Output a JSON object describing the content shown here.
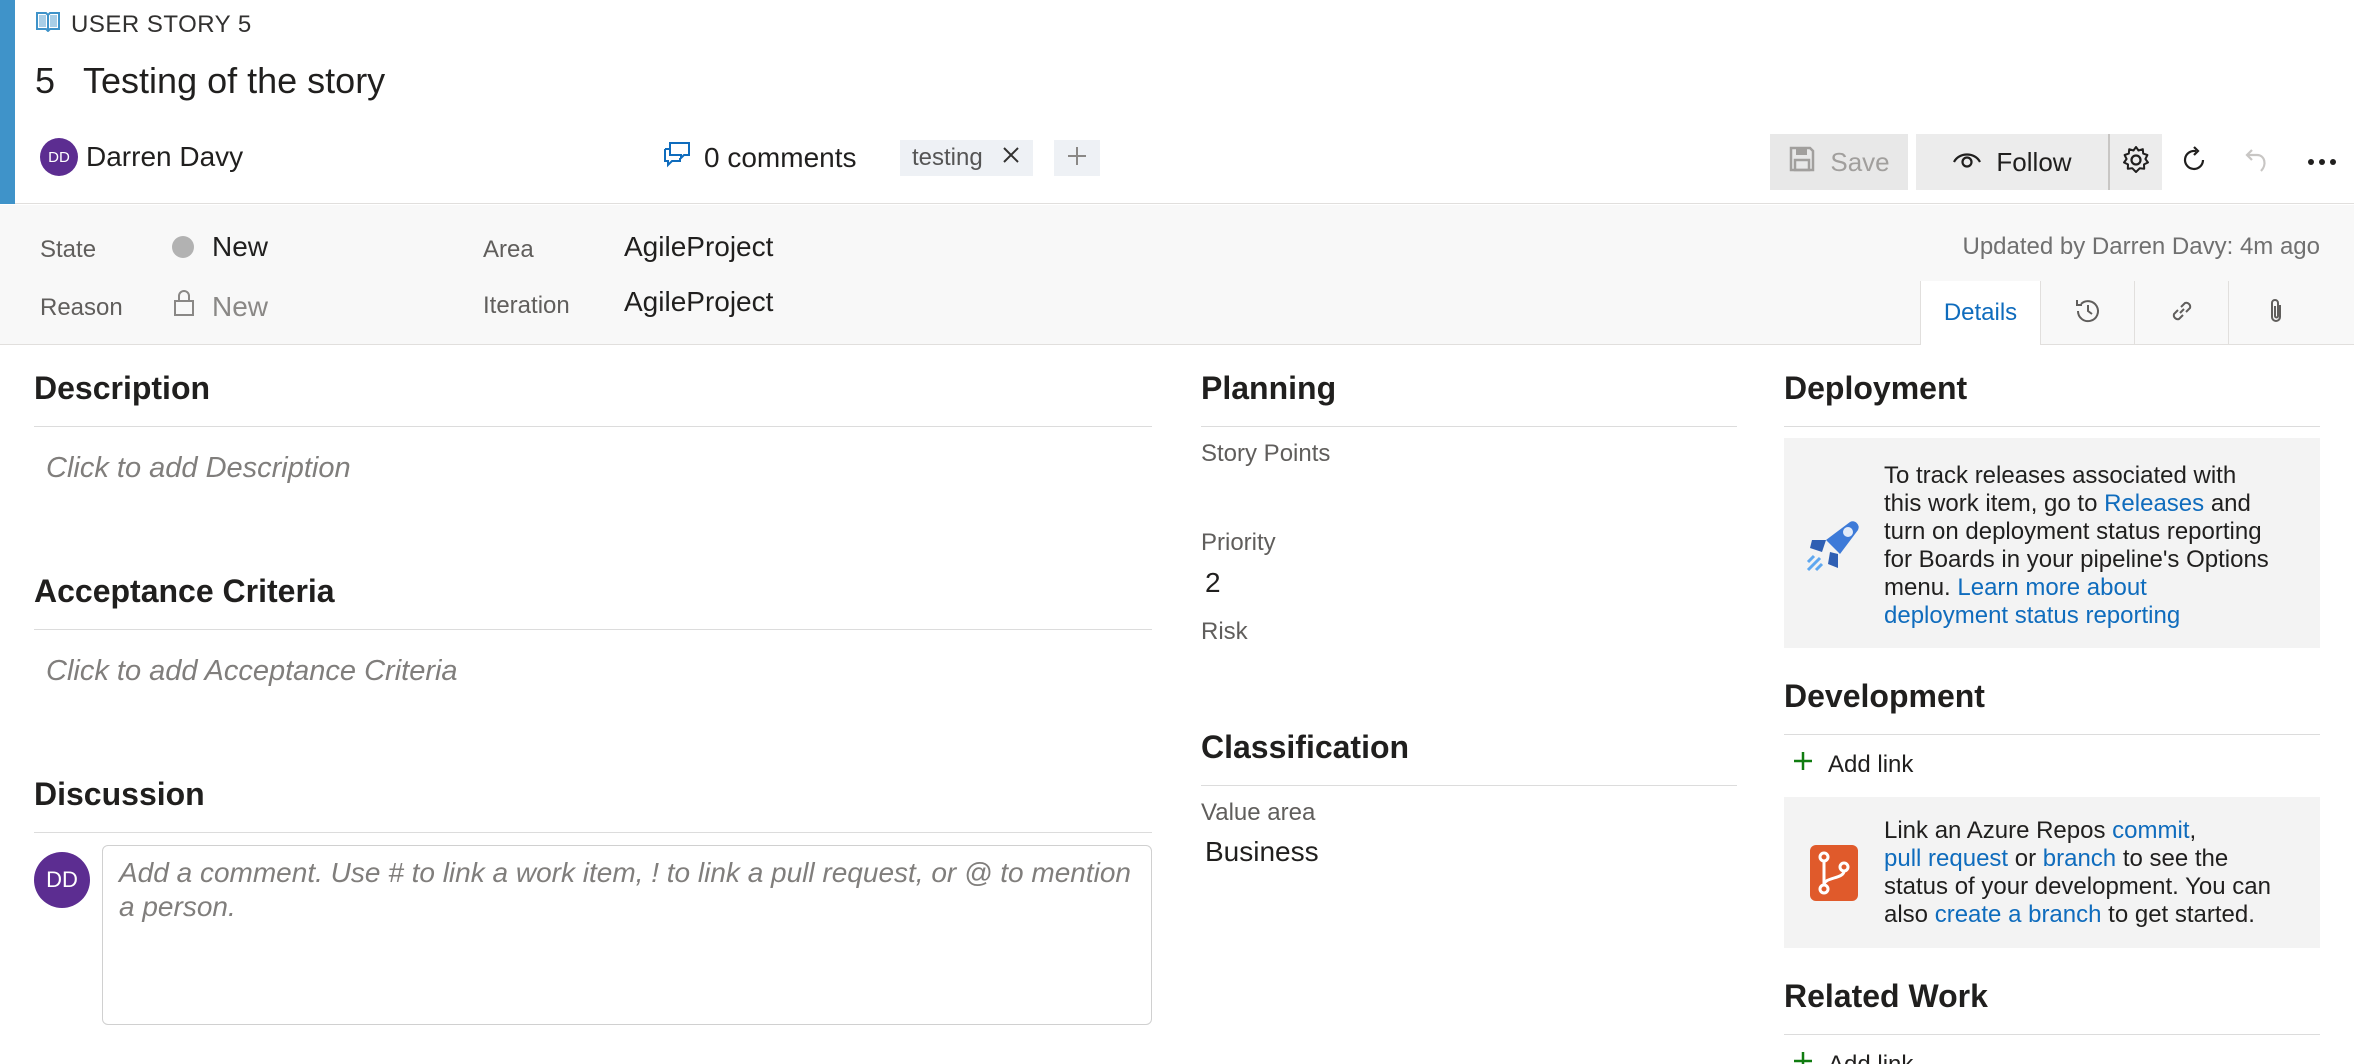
{
  "work_item": {
    "type_label": "USER STORY 5",
    "id": "5",
    "title": "Testing of the story",
    "assignee_initials": "DD",
    "assignee": "Darren Davy",
    "comments_label": "0 comments",
    "tag": "testing"
  },
  "toolbar": {
    "save_label": "Save",
    "follow_label": "Follow"
  },
  "fields": {
    "state_label": "State",
    "state_value": "New",
    "reason_label": "Reason",
    "reason_value": "New",
    "area_label": "Area",
    "area_value": "AgileProject",
    "iteration_label": "Iteration",
    "iteration_value": "AgileProject",
    "updated": "Updated by Darren Davy: 4m ago"
  },
  "tabs": {
    "details": "Details"
  },
  "left": {
    "description_title": "Description",
    "description_placeholder": "Click to add Description",
    "acceptance_title": "Acceptance Criteria",
    "acceptance_placeholder": "Click to add Acceptance Criteria",
    "discussion_title": "Discussion",
    "comment_placeholder": "Add a comment. Use # to link a work item, ! to link a pull request, or @ to mention a person."
  },
  "planning": {
    "title": "Planning",
    "story_points_label": "Story Points",
    "priority_label": "Priority",
    "priority_value": "2",
    "risk_label": "Risk"
  },
  "classification": {
    "title": "Classification",
    "value_area_label": "Value area",
    "value_area_value": "Business"
  },
  "deployment": {
    "title": "Deployment",
    "text_1": "To track releases associated with",
    "text_2": "this work item, go to",
    "link_releases": "Releases",
    "text_3": "and",
    "text_4": "turn on deployment status reporting",
    "text_5": "for Boards in your pipeline's Options",
    "text_6": "menu.",
    "link_learn_1": "Learn more about",
    "link_learn_2": "deployment status reporting"
  },
  "development": {
    "title": "Development",
    "add_link": "Add link",
    "text_1": "Link an Azure Repos",
    "link_commit": "commit",
    "comma": ",",
    "link_pull_request": "pull request",
    "text_or": "or",
    "link_branch": "branch",
    "text_2": "to see the",
    "text_3": "status of your development. You can",
    "text_4": "also",
    "link_create_branch": "create a branch",
    "text_5": "to get started."
  },
  "related": {
    "title": "Related Work",
    "add_link": "Add link"
  },
  "colors": {
    "accent": "#3f93c9",
    "avatar": "#5c2d91",
    "link": "#0f6cbd",
    "add_green": "#107c10"
  }
}
